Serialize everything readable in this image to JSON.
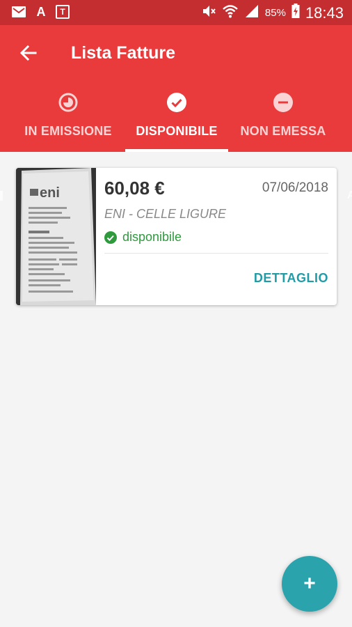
{
  "status_bar": {
    "left_icons": [
      "mail-icon",
      "font-a-icon",
      "t-box-icon"
    ],
    "t_box_text": "T",
    "a_text": "A",
    "battery": "85%",
    "time": "18:43"
  },
  "app_bar": {
    "title": "Lista Fatture",
    "back_icon": "arrow-left-icon"
  },
  "tabs": [
    {
      "label": "IN EMISSIONE",
      "icon": "clock-half-icon",
      "active": false
    },
    {
      "label": "DISPONIBILE",
      "icon": "check-circle-icon",
      "active": true
    },
    {
      "label": "NON EMESSA",
      "icon": "minus-circle-icon",
      "active": false
    }
  ],
  "invoices": [
    {
      "amount": "60,08 €",
      "date": "07/06/2018",
      "merchant": "ENI - CELLE LIGURE",
      "status": "disponibile",
      "status_icon": "check-circle-icon",
      "action": "DETTAGLIO"
    }
  ],
  "fab": {
    "label": "+"
  },
  "colors": {
    "status_bar": "#c42e31",
    "app_bar": "#e93b3c",
    "accent": "#239ba6",
    "fab": "#2aa3ad",
    "status_ok": "#2e9a3d"
  }
}
